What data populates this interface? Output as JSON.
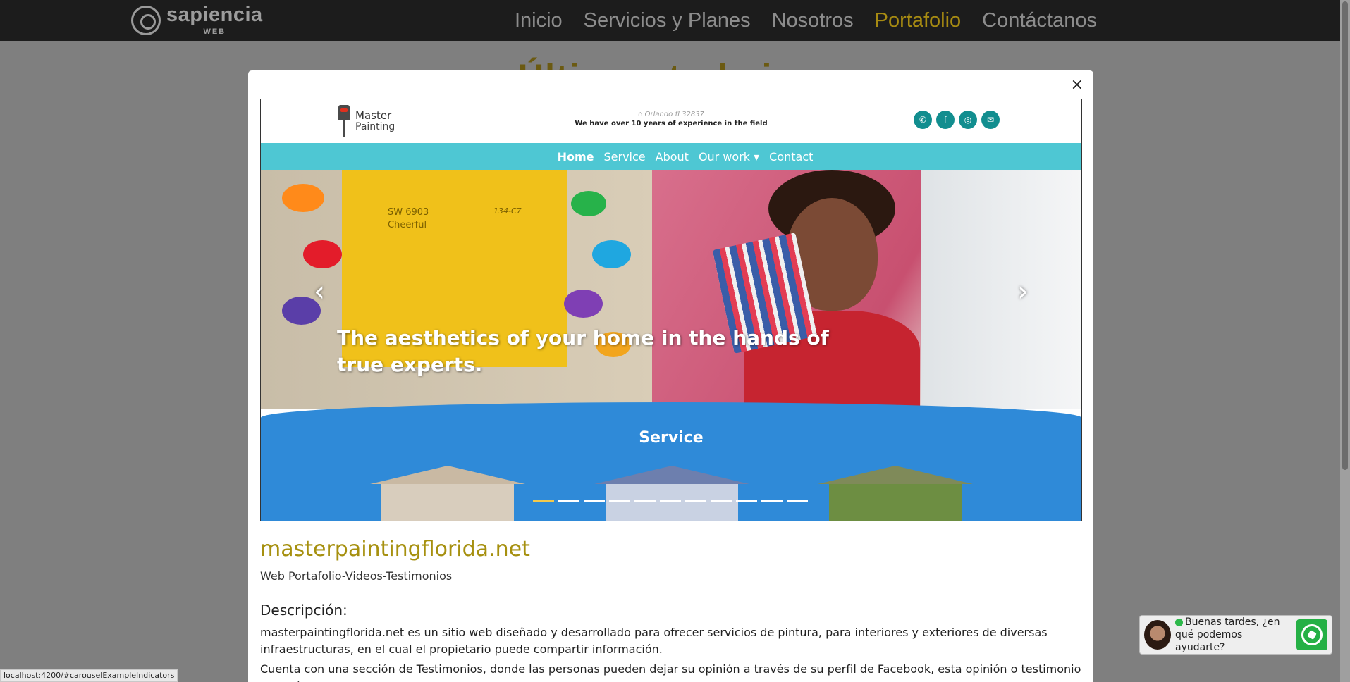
{
  "brand": {
    "name": "sapiencia",
    "sub": "WEB"
  },
  "nav": {
    "items": [
      {
        "label": "Inicio"
      },
      {
        "label": "Servicios y Planes"
      },
      {
        "label": "Nosotros"
      },
      {
        "label": "Portafolio"
      },
      {
        "label": "Contáctanos"
      }
    ],
    "active": "Portafolio"
  },
  "background_heading": "Últimos trabajos",
  "modal": {
    "close_label": "×",
    "embedded_site": {
      "brand_line1": "Master",
      "brand_line2": "Painting",
      "location": "Orlando fl 32837",
      "experience": "We have over 10 years of experience in the field",
      "social": [
        "whatsapp-icon",
        "facebook-icon",
        "instagram-icon",
        "mail-icon"
      ],
      "menu": [
        "Home",
        "Service",
        "About",
        "Our work ▾",
        "Contact"
      ],
      "swatch_code": "SW 6903",
      "swatch_name": "Cheerful",
      "swatch_id": "134-C7",
      "slide_caption": "The aesthetics of your home in the hands of true experts.",
      "prev_arrow": "‹",
      "next_arrow": "›",
      "service_title": "Service",
      "indicator_count": 11,
      "active_indicator": 0
    },
    "site_title": "masterpaintingflorida.net",
    "site_sub": "Web Portafolio-Videos-Testimonios",
    "desc_title": "Descripción:",
    "desc_p1": "masterpaintingflorida.net es un sitio web diseñado y desarrollado para ofrecer servicios de pintura, para interiores y exteriores de diversas infraestructuras, en el cual el propietario puede compartir información.",
    "desc_p2": "Cuenta con una sección de Testimonios, donde las personas pueden dejar su opinión a través de su perfil de Facebook, esta opinión o testimonio se verá"
  },
  "chat": {
    "line1": "Buenas tardes, ¿en",
    "line2": "qué podemos ayudarte?"
  },
  "status_url": "localhost:4200/#carouselExampleIndicators"
}
